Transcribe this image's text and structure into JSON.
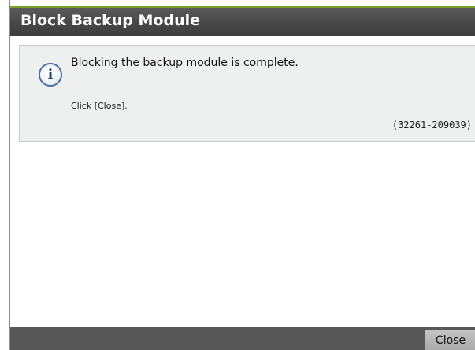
{
  "dialog": {
    "title": "Block Backup Module"
  },
  "message": {
    "icon": "info-icon",
    "text": "Blocking the backup module is complete.",
    "hint": "Click [Close].",
    "code": "(32261-209039)"
  },
  "footer": {
    "close_label": "Close"
  },
  "colors": {
    "titlebar": "#474747",
    "title_accent": "#7aa02a",
    "message_background": "#eef0f0",
    "footer": "#575757",
    "icon_blue": "#4a6fa5"
  }
}
